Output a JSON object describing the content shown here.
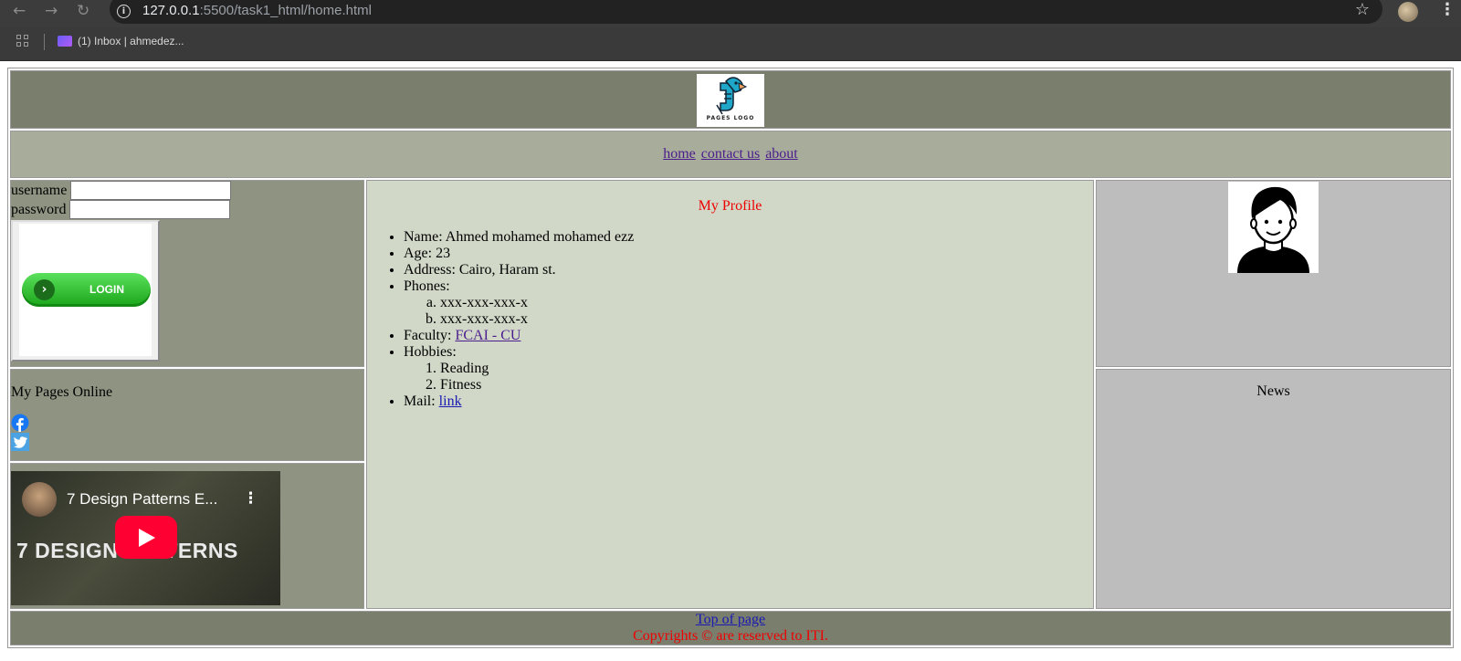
{
  "browser": {
    "url_host": "127.0.0.1",
    "url_rest": ":5500/task1_html/home.html",
    "bookmark_label": "(1) Inbox | ahmedez..."
  },
  "header": {
    "logo_text": "PAGES LOGO"
  },
  "nav": {
    "home": "home",
    "contact": "contact us",
    "about": "about"
  },
  "login": {
    "username_label": "username",
    "password_label": "password",
    "username_value": "",
    "password_value": "",
    "button_label": "LOGIN"
  },
  "online": {
    "title": "My Pages Online"
  },
  "video": {
    "title": "7 Design Patterns E...",
    "thumbnail_text": "7 DESIGN PATTERNS"
  },
  "profile": {
    "title": "My Profile",
    "name_label": "Name: ",
    "name": "Ahmed mohamed mohamed ezz",
    "age_label": "Age: ",
    "age": "23",
    "address_label": "Address: ",
    "address": "Cairo, Haram st.",
    "phones_label": "Phones:",
    "phones": [
      "xxx-xxx-xxx-x",
      "xxx-xxx-xxx-x"
    ],
    "faculty_label": "Faculty: ",
    "faculty_link": "FCAI - CU",
    "hobbies_label": "Hobbies:",
    "hobbies": [
      "Reading",
      "Fitness"
    ],
    "mail_label": "Mail: ",
    "mail_link": "link"
  },
  "news": {
    "title": "News"
  },
  "footer": {
    "top_link": "Top of page",
    "copyright": "Copyrights © are reserved to ITI."
  },
  "colors": {
    "header": "#7a7e6d",
    "nav": "#a8ac9b",
    "left": "#8f9482",
    "middle": "#d1d8c8",
    "right": "#bdbdbd",
    "accent_red": "#e00000"
  }
}
